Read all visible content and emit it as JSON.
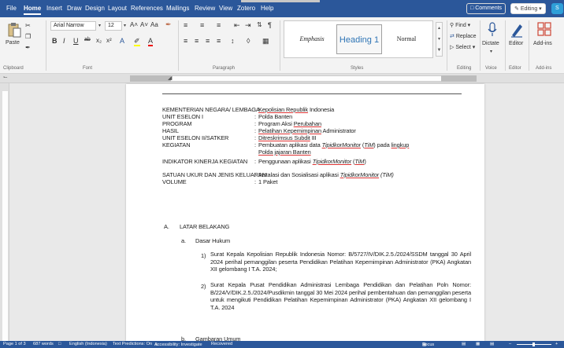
{
  "menu": {
    "tabs": [
      "File",
      "Home",
      "Insert",
      "Draw",
      "Design",
      "Layout",
      "References",
      "Mailings",
      "Review",
      "View",
      "Zotero",
      "Help"
    ],
    "active": "Home",
    "comments": "Comments",
    "editing": "Editing",
    "share_glyph": "S"
  },
  "ribbon": {
    "clipboard": {
      "paste": "Paste",
      "label": "Clipboard"
    },
    "font": {
      "name": "Arial Narrow",
      "size": "12",
      "label": "Font",
      "grow": "A˄",
      "shrink": "A˅",
      "case": "Aa",
      "bold": "B",
      "italic": "I",
      "underline": "U",
      "strike": "ab",
      "sub": "x₂",
      "sup": "x²"
    },
    "paragraph": {
      "label": "Paragraph",
      "pilcrow": "¶"
    },
    "styles": {
      "label": "Styles",
      "items": [
        "Emphasis",
        "Heading 1",
        "Normal"
      ]
    },
    "editing": {
      "find": "Find",
      "replace": "Replace",
      "select": "Select",
      "label": "Editing"
    },
    "voice": {
      "dictate": "Dictate",
      "label": "Voice"
    },
    "editor": {
      "name": "Editor",
      "label": "Editor"
    },
    "addins": {
      "name": "Add-ins",
      "label": "Add-ins"
    }
  },
  "document": {
    "header_rows": [
      {
        "label": "KEMENTERIAN NEGARA/ LEMBAGA",
        "parts": [
          {
            "t": "Kepolisian Republik",
            "u": true
          },
          {
            "t": " Indonesia"
          }
        ]
      },
      {
        "label": "UNIT ESELON I",
        "parts": [
          {
            "t": "Polda Banten"
          }
        ]
      },
      {
        "label": "PROGRAM",
        "parts": [
          {
            "t": "Program Aksi "
          },
          {
            "t": "Perubahan",
            "u": true
          }
        ]
      },
      {
        "label": "HASIL",
        "parts": [
          {
            "t": "Pelatihan Kepemimpinan",
            "u": true
          },
          {
            "t": " Administrator"
          }
        ]
      },
      {
        "label": "UNIT ESELON II/SATKER",
        "parts": [
          {
            "t": "Ditreskrimsus Subdit",
            "u": true
          },
          {
            "t": " III"
          }
        ]
      },
      {
        "label": "KEGIATAN",
        "parts": [
          {
            "t": "Pembuatan aplikasi data "
          },
          {
            "t": "TipidkorMonitor",
            "u": true,
            "i": true
          },
          {
            "t": " ("
          },
          {
            "t": "TiM",
            "u": true,
            "i": true
          },
          {
            "t": ") pada "
          },
          {
            "t": "lingkup",
            "u": true
          }
        ]
      },
      {
        "label": "",
        "parts": [
          {
            "t": "Polda jajaran Banten",
            "u": true
          }
        ]
      },
      {
        "label": "INDIKATOR KINERJA KEGIATAN",
        "parts": [
          {
            "t": "Penggunaan aplikasi "
          },
          {
            "t": "TipidkorMonitor",
            "u": true,
            "i": true
          },
          {
            "t": " ("
          },
          {
            "t": "TiM",
            "u": true,
            "i": true
          },
          {
            "t": ")"
          }
        ]
      },
      {
        "label": "SATUAN UKUR DAN JENIS KELUARAN",
        "parts": [
          {
            "t": "Instalasi dan Sosialisasi aplikasi "
          },
          {
            "t": "TipidkorMonitor",
            "u": true,
            "i": true
          },
          {
            "t": " (TiM)",
            "i": true
          }
        ]
      },
      {
        "label": "VOLUME",
        "parts": [
          {
            "t": "1 Paket"
          }
        ]
      }
    ],
    "section_a": {
      "letter": "A.",
      "title": "LATAR BELAKANG"
    },
    "sub_a": {
      "letter": "a.",
      "title": "Dasar Hukum"
    },
    "items": [
      {
        "num": "1)",
        "text": "Surat Kepala Kepolisian Republik Indonesia Nomor: B/5727/IV/DIK.2.5./2024/SSDM tanggal 30 April 2024 perihal pemanggilan peserta Pendidikan Pelatihan Kepemimpinan Administrator (PKA) Angkatan XII gelombang I T.A. 2024;"
      },
      {
        "num": "2)",
        "text": "Surat Kepala Pusat Pendidikan Administrasi Lembaga Pendidikan dan Pelatihan Poln Nomor: B/224/V/DIK.2.5./2024/Pusdikmin tanggal 30 Mei 2024 perihal pembentahuan dan pemanggilan peserta untuk mengikuti Pendidikan Pelatihan Kepemimpinan Administrator (PKA) Angkatan XII gelombang I T.A. 2024"
      }
    ],
    "sub_b": {
      "letter": "b.",
      "title": "Gambaran Umum"
    }
  },
  "status": {
    "page": "Page 1 of 3",
    "words": "687 words",
    "language": "English (Indonesia)",
    "predictions": "Text Predictions: On",
    "accessibility": "Accessibility: Investigate",
    "recovered": "Recovered",
    "focus": "Focus"
  },
  "colors": {
    "brand": "#2b579a",
    "heading": "#2e74b5",
    "squiggle": "#dd3333"
  }
}
